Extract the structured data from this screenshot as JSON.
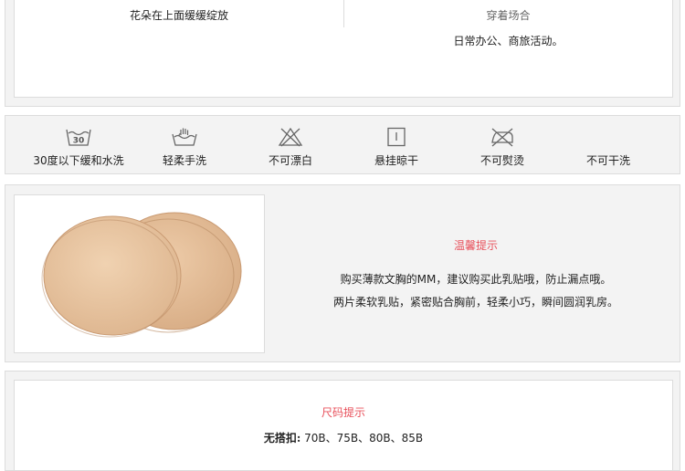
{
  "top": {
    "left_text": "花朵在上面缓缓绽放",
    "wear_title": "穿着场合",
    "wear_value": "日常办公、商旅活动。"
  },
  "care": [
    {
      "label": "30度以下缓和水洗",
      "icon": "wash-30-icon",
      "icon_text": "30"
    },
    {
      "label": "轻柔手洗",
      "icon": "hand-wash-icon"
    },
    {
      "label": "不可漂白",
      "icon": "no-bleach-icon"
    },
    {
      "label": "悬挂晾干",
      "icon": "hang-dry-icon"
    },
    {
      "label": "不可熨烫",
      "icon": "no-iron-icon"
    },
    {
      "label": "不可干洗",
      "icon": "no-dry-clean-icon"
    }
  ],
  "tip": {
    "title": "温馨提示",
    "line1": "购买薄款文胸的MM，建议购买此乳贴哦，防止漏点哦。",
    "line2": "两片柔软乳贴，紧密贴合胸前，轻柔小巧，瞬间圆润乳房。"
  },
  "size": {
    "title": "尺码提示",
    "label": "无搭扣:",
    "value": " 70B、75B、80B、85B"
  },
  "colors": {
    "accent": "#e8505b",
    "panel_bg": "#f3f3f3",
    "border": "#dcdcdc",
    "pad_fill": "#e8c4a0"
  }
}
